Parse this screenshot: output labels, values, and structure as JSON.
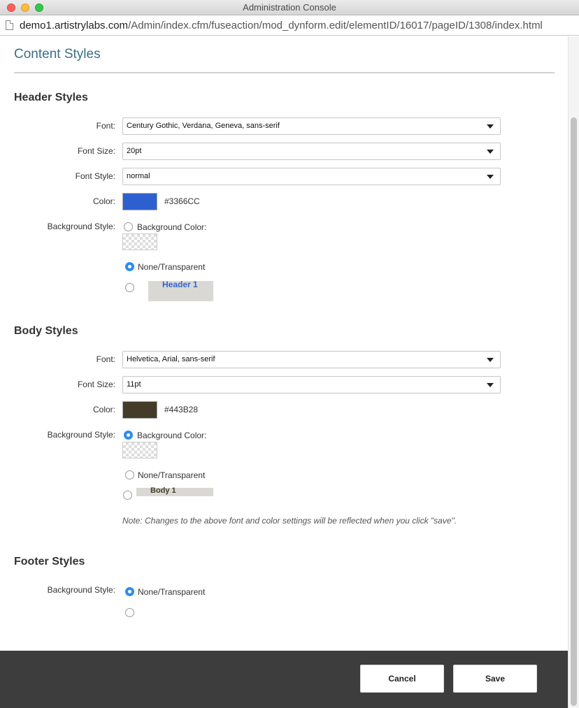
{
  "window": {
    "title": "Administration Console"
  },
  "address": {
    "host": "demo1.artistrylabs.com",
    "path": "/Admin/index.cfm/fuseaction/mod_dynform.edit/elementID/16017/pageID/1308/index.html"
  },
  "page": {
    "title": "Content Styles"
  },
  "header_styles": {
    "section_title": "Header Styles",
    "font_label": "Font:",
    "font_value": "Century Gothic, Verdana, Geneva, sans-serif",
    "font_size_label": "Font Size:",
    "font_size_value": "20pt",
    "font_style_label": "Font Style:",
    "font_style_value": "normal",
    "color_label": "Color:",
    "color_value": "#3366CC",
    "bg_style_label": "Background Style:",
    "bg_color_option": "Background Color:",
    "none_option": "None/Transparent",
    "preview_text": "Header 1",
    "selected_option": "none"
  },
  "body_styles": {
    "section_title": "Body Styles",
    "font_label": "Font:",
    "font_value": "Helvetica, Arial, sans-serif",
    "font_size_label": "Font Size:",
    "font_size_value": "11pt",
    "color_label": "Color:",
    "color_value": "#443B28",
    "bg_style_label": "Background Style:",
    "bg_color_option": "Background Color:",
    "none_option": "None/Transparent",
    "preview_text": "Body 1",
    "selected_option": "background-color",
    "note": "Note: Changes to the above font and color settings will be reflected when you click \"save\"."
  },
  "footer_styles": {
    "section_title": "Footer Styles",
    "bg_style_label": "Background Style:",
    "none_option": "None/Transparent",
    "selected_option": "none"
  },
  "actions": {
    "cancel_label": "Cancel",
    "save_label": "Save"
  },
  "colors": {
    "header_swatch": "#2E5FCF",
    "body_swatch": "#443B28",
    "accent": "#2F8CF0",
    "title": "#3C7086"
  }
}
